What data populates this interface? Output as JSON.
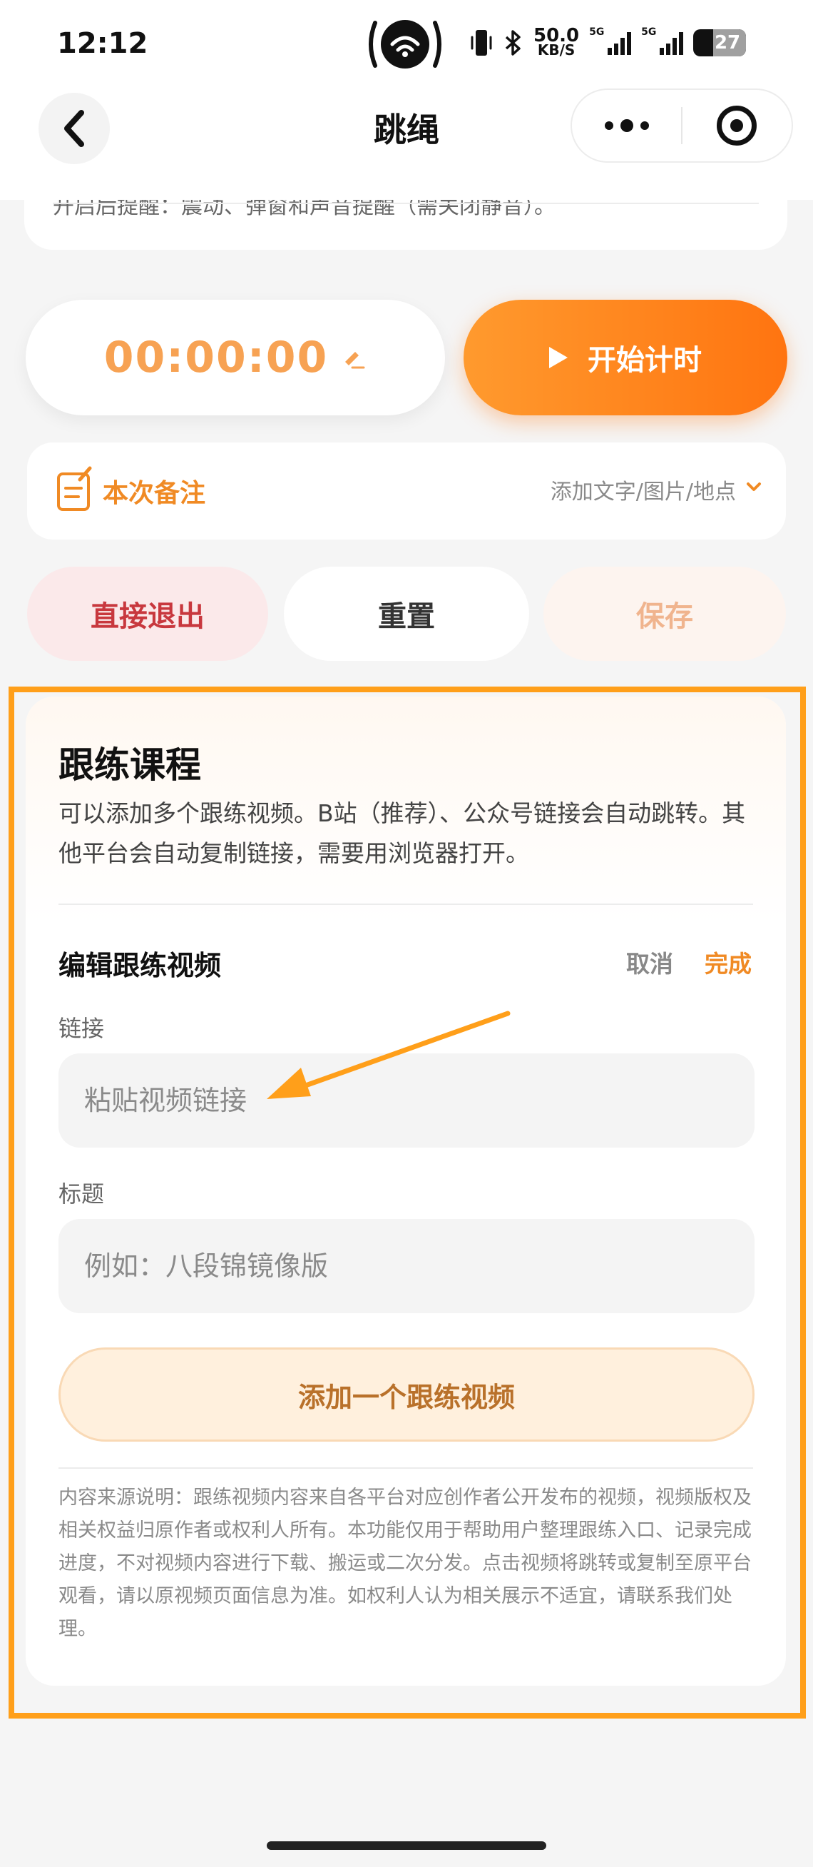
{
  "status_bar": {
    "time": "12:12",
    "net_speed_value": "50.0",
    "net_speed_unit": "KB/S",
    "signal1_label": "5G",
    "signal2_label": "5G",
    "battery": "27"
  },
  "nav": {
    "title": "跳绳"
  },
  "top_card": {
    "cut_text": "开启后提醒：震动、弹窗和声音提醒（需关闭静音）。"
  },
  "timer": {
    "value": "00:00:00",
    "start_label": "开始计时"
  },
  "notes": {
    "title": "本次备注",
    "hint": "添加文字/图片/地点"
  },
  "actions": {
    "exit_label": "直接退出",
    "reset_label": "重置",
    "save_label": "保存"
  },
  "course": {
    "title": "跟练课程",
    "description": "可以添加多个跟练视频。B站（推荐）、公众号链接会自动跳转。其他平台会自动复制链接，需要用浏览器打开。",
    "edit_title": "编辑跟练视频",
    "cancel_label": "取消",
    "done_label": "完成",
    "link_label": "链接",
    "link_placeholder": "粘贴视频链接",
    "title_label": "标题",
    "title_placeholder": "例如：八段锦镜像版",
    "add_button_label": "添加一个跟练视频",
    "disclaimer": "内容来源说明：跟练视频内容来自各平台对应创作者公开发布的视频，视频版权及相关权益归原作者或权利人所有。本功能仅用于帮助用户整理跟练入口、记录完成进度，不对视频内容进行下载、搬运或二次分发。点击视频将跳转或复制至原平台观看，请以原视频页面信息为准。如权利人认为相关展示不适宜，请联系我们处理。"
  },
  "colors": {
    "accent": "#ff8a1f",
    "timer_text": "#f7a253",
    "exit_text": "#c8383e",
    "highlight_border": "#ff9f1a"
  }
}
